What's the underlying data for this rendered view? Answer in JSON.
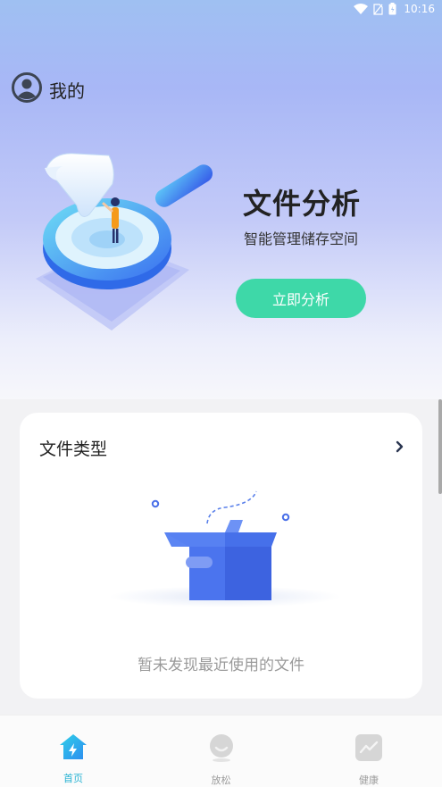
{
  "status_bar": {
    "time": "10:16"
  },
  "profile": {
    "label": "我的"
  },
  "hero": {
    "title": "文件分析",
    "subtitle": "智能管理储存空间",
    "button_label": "立即分析"
  },
  "file_types_card": {
    "title": "文件类型",
    "empty_text": "暂未发现最近使用的文件"
  },
  "bottom_nav": {
    "items": [
      {
        "label": "首页",
        "icon": "home-bolt-icon",
        "active": true
      },
      {
        "label": "放松",
        "icon": "relax-face-icon",
        "active": false
      },
      {
        "label": "健康",
        "icon": "health-chart-icon",
        "active": false
      }
    ]
  },
  "colors": {
    "accent": "#3ed8a8",
    "nav_active": "#29b3d3",
    "nav_inactive": "#9b9b9b"
  }
}
